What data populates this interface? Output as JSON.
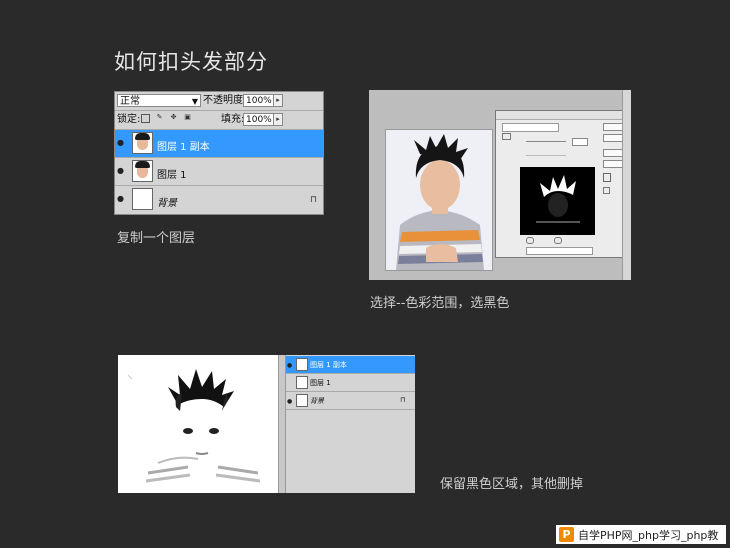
{
  "title": "如何扣头发部分",
  "step1": {
    "caption": "复制一个图层",
    "blend_mode": "正常",
    "opacity_label": "不透明度:",
    "opacity_value": "100%",
    "lock_label": "锁定:",
    "fill_label": "填充:",
    "fill_value": "100%",
    "layers": [
      {
        "name": "图层 1 副本"
      },
      {
        "name": "图层 1"
      },
      {
        "name": "背景"
      }
    ]
  },
  "step2": {
    "caption": "选择--色彩范围，选黑色"
  },
  "step3": {
    "caption": "保留黑色区域，其他删掉",
    "layers": [
      {
        "name": "图层 1 副本"
      },
      {
        "name": "图层 1"
      },
      {
        "name": "背景"
      }
    ]
  },
  "watermark": {
    "logo": "P",
    "text": "自学PHP网_php学习_php教"
  }
}
